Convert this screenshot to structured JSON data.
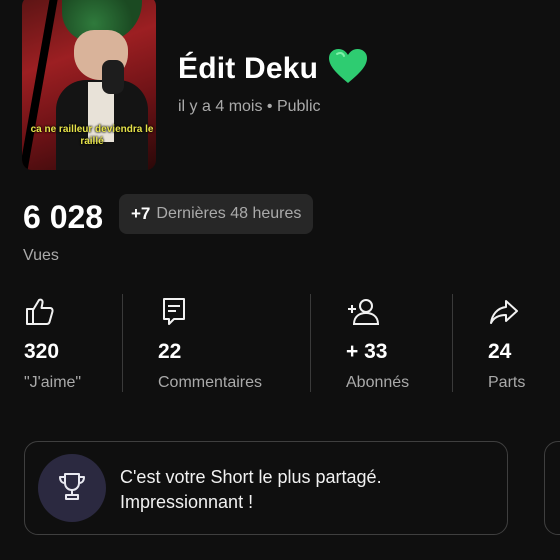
{
  "video": {
    "title": "Édit Deku",
    "meta": "il y a 4 mois • Public",
    "thumbnail_caption": "ca ne railleur deviendra le raillé",
    "emoji": "green-heart-icon",
    "accent_color": "#2ecc71"
  },
  "views": {
    "count": "6 028",
    "delta": "+7",
    "delta_label": "Dernières 48 heures",
    "label": "Vues"
  },
  "stats": [
    {
      "icon": "thumbs-up-icon",
      "value": "320",
      "label": "\"J'aime\""
    },
    {
      "icon": "comment-icon",
      "value": "22",
      "label": "Commentaires"
    },
    {
      "icon": "add-person-icon",
      "value": "+ 33",
      "label": "Abonnés"
    },
    {
      "icon": "share-icon",
      "value": "24",
      "label": "Parts"
    }
  ],
  "insight": {
    "icon": "trophy-icon",
    "line1": "C'est votre Short le plus partagé.",
    "line2": "Impressionnant !"
  }
}
